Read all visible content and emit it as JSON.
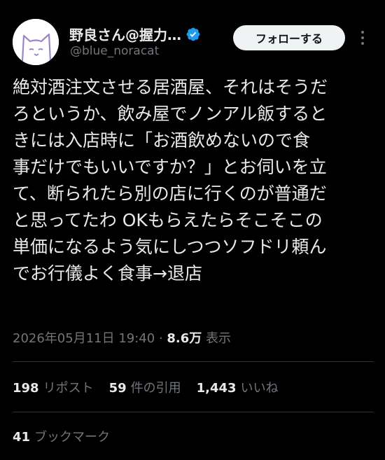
{
  "author": {
    "display_name": "野良さん@握力…",
    "handle": "@blue_noracat",
    "verified": true,
    "avatar": "cat-avatar-icon"
  },
  "follow_label": "フォローする",
  "tweet_lines": [
    "絶対酒注文させる居酒屋、それはそうだ",
    "ろというか、飲み屋でノンアル飯すると",
    "きには入店時に「お酒飲めないので食",
    "事だけでもいいですか？」とお伺いを立",
    "て、断られたら別の店に行くのが普通だ",
    "と思ってたわ OKもらえたらそこそこの",
    "単価になるよう気にしつつソフドリ頼ん",
    "でお行儀よく食事→退店"
  ],
  "meta": {
    "datetime": "2026年05月11日 19:40",
    "separator": " · ",
    "views_count": "8.6万",
    "views_label": " 表示"
  },
  "stats": [
    {
      "count": "198",
      "label": "リポスト"
    },
    {
      "count": "59",
      "label": "件の引用"
    },
    {
      "count": "1,443",
      "label": "いいね"
    }
  ],
  "bookmarks": {
    "count": "41",
    "label": "ブックマーク"
  },
  "colors": {
    "background": "#000000",
    "text": "#e7e9ea",
    "secondary": "#71767b",
    "verified": "#1d9bf0",
    "divider": "#2f3336"
  }
}
